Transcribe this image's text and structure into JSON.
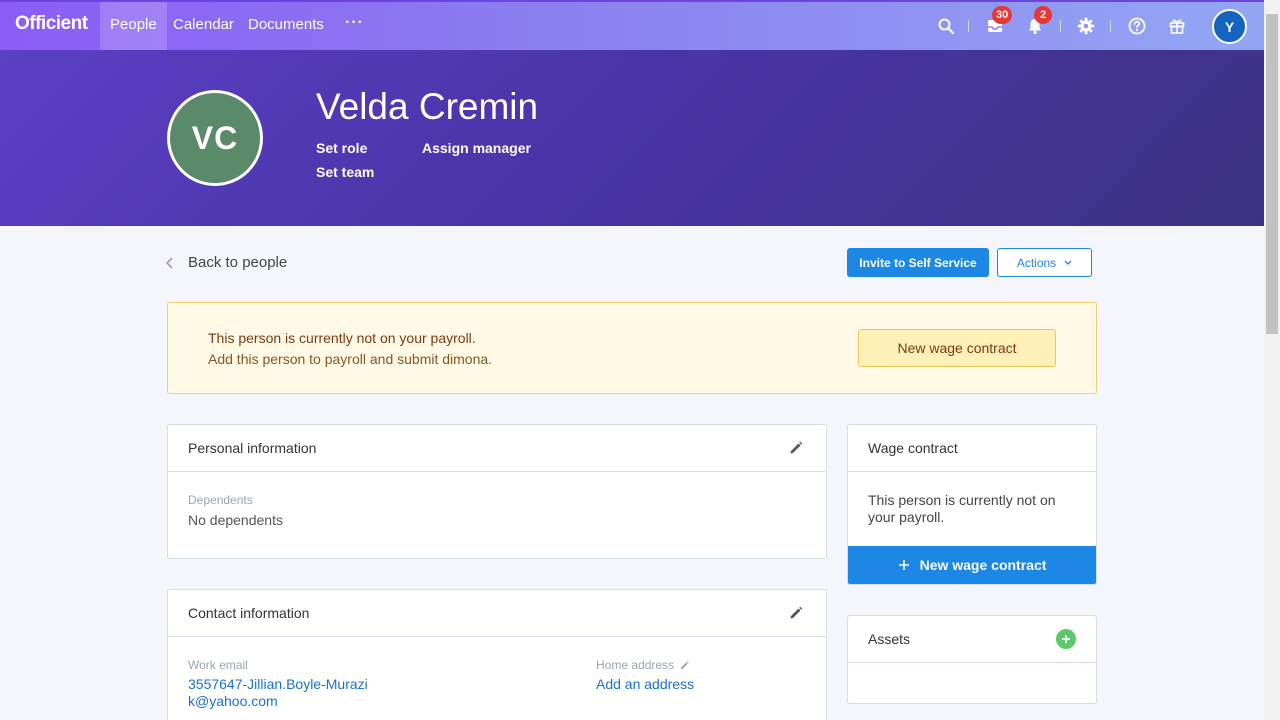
{
  "nav": {
    "logo": "Officient",
    "items": [
      {
        "label": "People",
        "active": true
      },
      {
        "label": "Calendar",
        "active": false
      },
      {
        "label": "Documents",
        "active": false
      }
    ],
    "more": "···",
    "inbox_badge": "30",
    "notifications_badge": "2",
    "user_initial": "Y",
    "icons": [
      "search-icon",
      "inbox-icon",
      "bell-icon",
      "gear-icon",
      "help-icon",
      "gift-icon"
    ]
  },
  "person": {
    "initials": "VC",
    "name": "Velda Cremin",
    "set_role": "Set role",
    "assign_manager": "Assign manager",
    "set_team": "Set team",
    "avatar_color": "#5a8a6a"
  },
  "toolbar": {
    "back": "Back to people",
    "invite": "Invite to Self Service",
    "actions": "Actions"
  },
  "alert": {
    "title": "This person is currently not on your payroll.",
    "text": "Add this person to payroll and submit dimona.",
    "button": "New wage contract"
  },
  "personal": {
    "title": "Personal information",
    "dependents_label": "Dependents",
    "dependents_value": "No dependents"
  },
  "contact": {
    "title": "Contact information",
    "work_email_label": "Work email",
    "work_email_line1": "3557647-Jillian.Boyle-Murazi",
    "work_email_line2": "k@yahoo.com",
    "home_address_label": "Home address",
    "home_address_value": "Add an address"
  },
  "wage": {
    "title": "Wage contract",
    "text": "This person is currently not on your payroll.",
    "button": "New wage contract"
  },
  "assets": {
    "title": "Assets"
  },
  "colors": {
    "primary": "#1c87e5",
    "hero": "#4a35a8",
    "alert_bg": "#fff9e6",
    "badge": "#e53935",
    "add_green": "#5bc96a"
  }
}
